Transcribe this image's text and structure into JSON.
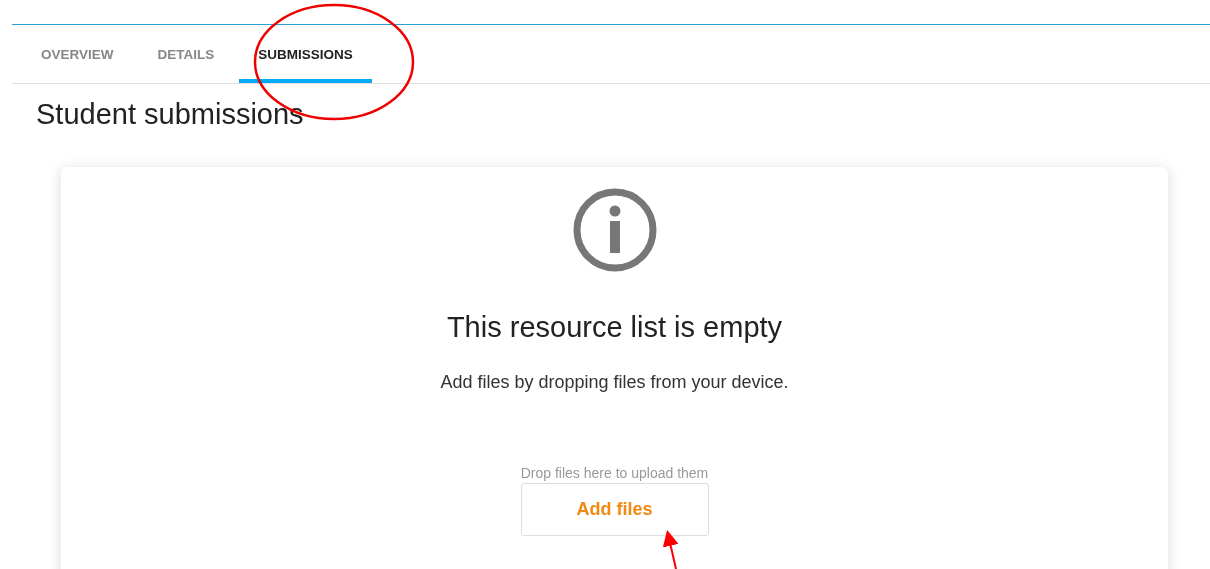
{
  "tabs": [
    {
      "label": "OVERVIEW",
      "selected": false
    },
    {
      "label": "DETAILS",
      "selected": false
    },
    {
      "label": "SUBMISSIONS",
      "selected": true
    }
  ],
  "heading": "Student submissions",
  "empty_state": {
    "title": "This resource list is empty",
    "message": "Add files by dropping files from your device.",
    "drop_hint": "Drop files here to upload them",
    "button": "Add files"
  }
}
